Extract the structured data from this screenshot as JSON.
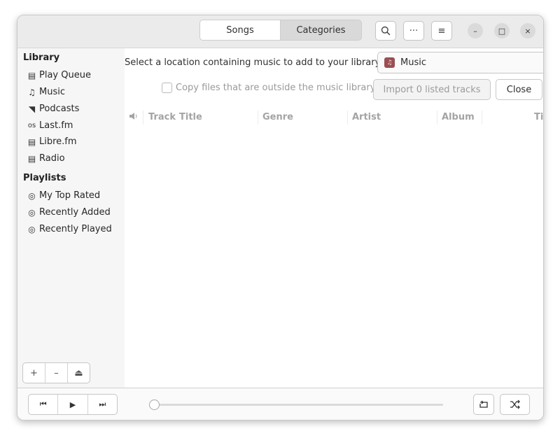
{
  "header": {
    "tabs": [
      {
        "label": "Songs"
      },
      {
        "label": "Categories"
      }
    ],
    "search_icon": "search-icon",
    "more_label": "···",
    "menu_label": "≡"
  },
  "window_controls": {
    "minimize": "–",
    "maximize": "□",
    "close": "×"
  },
  "sidebar": {
    "library_title": "Library",
    "library_items": [
      {
        "label": "Play Queue",
        "icon": "▤"
      },
      {
        "label": "Music",
        "icon": "♫"
      },
      {
        "label": "Podcasts",
        "icon": "◥"
      },
      {
        "label": "Last.fm",
        "icon": "os"
      },
      {
        "label": "Libre.fm",
        "icon": "▤"
      },
      {
        "label": "Radio",
        "icon": "▤"
      }
    ],
    "playlists_title": "Playlists",
    "playlist_items": [
      {
        "label": "My Top Rated",
        "icon": "◎"
      },
      {
        "label": "Recently Added",
        "icon": "◎"
      },
      {
        "label": "Recently Played",
        "icon": "◎"
      }
    ],
    "buttons": {
      "add": "+",
      "remove": "–",
      "eject": "⏏"
    }
  },
  "import": {
    "location_label": "Select a location containing music to add to your library:",
    "location_value": "Music",
    "copy_checkbox_label": "Copy files that are outside the music library",
    "copy_checked": false,
    "import_button": "Import 0 listed tracks",
    "close_button": "Close"
  },
  "table": {
    "columns": [
      "Track",
      "Title",
      "Genre",
      "Artist",
      "Album",
      "Ti"
    ]
  },
  "footer": {
    "prev": "⏮",
    "play": "▶",
    "next": "⏭",
    "progress": 0,
    "repeat_icon": "repeat-icon",
    "shuffle_icon": "shuffle-icon"
  }
}
